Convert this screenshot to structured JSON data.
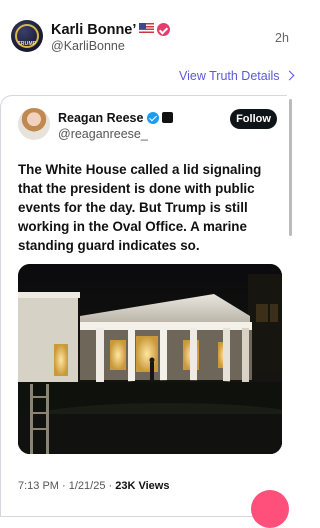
{
  "post": {
    "display_name": "Karli Bonne’",
    "handle": "@KarliBonne",
    "time": "2h",
    "avatar_text": "TRUMP",
    "view_truth_details": "View Truth Details",
    "flag_icon": "us-flag-icon",
    "verified_icon": "pink-verified-check-icon"
  },
  "embed": {
    "author_name": "Reagan Reese",
    "author_handle": "@reaganreese_",
    "follow_label": "Follow",
    "text": "The White House called a lid signaling that the president is done with public events for the day. But Trump is still working in the Oval Office. A marine standing guard indicates so.",
    "timestamp": "7:13 PM · 1/21/25 · ",
    "views": "23K Views",
    "image_description_icon": "white-house-night-photo"
  },
  "colors": {
    "link": "#5a5ad6",
    "verified_pink": "#e43d6b",
    "verified_blue": "#1d9bf0",
    "follow_bg": "#0f1419",
    "fab": "#ff4f7b"
  }
}
